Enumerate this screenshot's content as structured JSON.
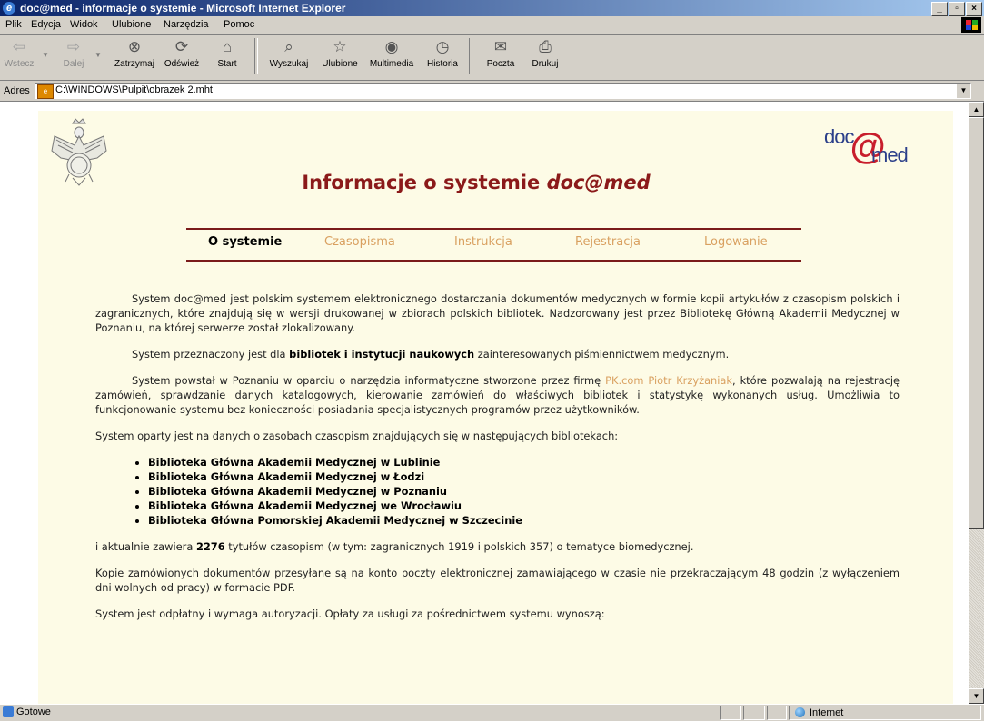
{
  "window": {
    "title": "doc@med - informacje o systemie - Microsoft Internet Explorer"
  },
  "menu": [
    "Plik",
    "Edycja",
    "Widok",
    "Ulubione",
    "Narzędzia",
    "Pomoc"
  ],
  "toolbar": {
    "back": "Wstecz",
    "forward": "Dalej",
    "stop": "Zatrzymaj",
    "refresh": "Odśwież",
    "home": "Start",
    "search": "Wyszukaj",
    "favorites": "Ulubione",
    "media": "Multimedia",
    "history": "Historia",
    "mail": "Poczta",
    "print": "Drukuj"
  },
  "address": {
    "label": "Adres",
    "value": "C:\\WINDOWS\\Pulpit\\obrazek 2.mht"
  },
  "status": {
    "text": "Gotowe",
    "zone": "Internet"
  },
  "page": {
    "title_prefix": "Informacje o systemie ",
    "title_brand": "doc@med",
    "logo": {
      "d": "doc",
      "at": "@",
      "m": "med"
    },
    "nav": [
      "O systemie",
      "Czasopisma",
      "Instrukcja",
      "Rejestracja",
      "Logowanie"
    ],
    "p1": "System doc@med jest polskim systemem elektronicznego dostarczania dokumentów medycznych w formie kopii artykułów z czasopism polskich i zagranicznych, które znajdują się w wersji drukowanej w zbiorach polskich bibliotek. Nadzorowany jest przez Bibliotekę Główną Akademii Medycznej w Poznaniu, na której serwerze został zlokalizowany.",
    "p2_a": "System przeznaczony jest dla ",
    "p2_b": "bibliotek i instytucji naukowych",
    "p2_c": " zainteresowanych piśmiennictwem medycznym.",
    "p3_a": "System powstał w Poznaniu w oparciu o narzędzia informatyczne stworzone przez firmę ",
    "p3_link": "PK.com Piotr Krzyżaniak",
    "p3_c": ", które pozwalają na rejestrację zamówień, sprawdzanie danych katalogowych, kierowanie zamówień do właściwych bibliotek i statystykę wykonanych usług. Umożliwia to funkcjonowanie systemu bez konieczności posiadania specjalistycznych programów przez użytkowników.",
    "p4": "System oparty jest na danych o zasobach czasopism znajdujących się w następujących bibliotekach:",
    "libraries": [
      "Biblioteka Główna Akademii Medycznej w Lublinie",
      "Biblioteka Główna Akademii Medycznej w Łodzi",
      "Biblioteka Główna Akademii Medycznej w Poznaniu",
      "Biblioteka Główna Akademii Medycznej we Wrocławiu",
      "Biblioteka Główna Pomorskiej Akademii Medycznej w Szczecinie"
    ],
    "p5_a": "i aktualnie zawiera ",
    "p5_b": "2276",
    "p5_c": " tytułów czasopism (w tym: zagranicznych 1919 i polskich 357) o tematyce biomedycznej.",
    "p6": "Kopie zamówionych dokumentów przesyłane są na konto poczty elektronicznej zamawiającego w czasie nie przekraczającym 48 godzin (z wyłączeniem dni wolnych od pracy) w formacie PDF.",
    "p7": "System jest odpłatny i wymaga autoryzacji. Opłaty za usługi za pośrednictwem systemu wynoszą:"
  }
}
